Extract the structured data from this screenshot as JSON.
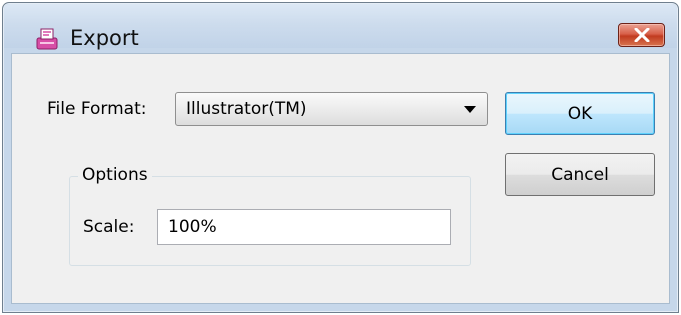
{
  "window": {
    "title": "Export",
    "app_icon": "export-app-icon",
    "close_icon": "close-icon"
  },
  "form": {
    "file_format_label": "File Format:",
    "file_format_value": "Illustrator(TM)",
    "options_group_label": "Options",
    "scale_label": "Scale:",
    "scale_value": "100%"
  },
  "buttons": {
    "ok_label": "OK",
    "cancel_label": "Cancel"
  },
  "colors": {
    "title_bar": "#c6d7ea",
    "close_button": "#c9482e",
    "client_background": "#f0f0f0",
    "default_button_border": "#3c7fb1"
  }
}
